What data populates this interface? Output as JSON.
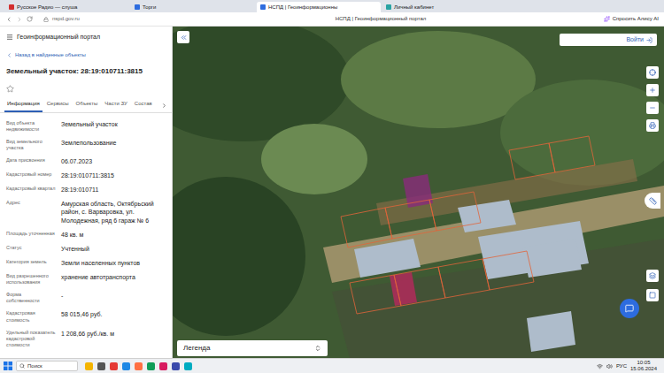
{
  "browser": {
    "tabs": [
      {
        "label": "Русское Радио — слуша",
        "selected": false
      },
      {
        "label": "Торги",
        "selected": false
      },
      {
        "label": "НСПД | Геоинформационны",
        "selected": true
      },
      {
        "label": "Личный кабинет",
        "selected": false
      }
    ],
    "address": "nspd.gov.ru",
    "title": "НСПД | Геоинформационный портал",
    "assistant": "Спросить Алису AI"
  },
  "panel": {
    "title": "Геоинформационный портал",
    "back": "Назад в найденные объекты",
    "heading": "Земельный участок: 28:19:010711:3815",
    "tabs": [
      {
        "label": "Информация",
        "selected": true
      },
      {
        "label": "Сервисы",
        "selected": false
      },
      {
        "label": "Объекты",
        "selected": false
      },
      {
        "label": "Части ЗУ",
        "selected": false
      },
      {
        "label": "Состав",
        "selected": false
      }
    ],
    "properties": [
      {
        "label": "Вид объекта недвижимости",
        "value": "Земельный участок"
      },
      {
        "label": "Вид земельного участка",
        "value": "Землепользование"
      },
      {
        "label": "Дата присвоения",
        "value": "06.07.2023"
      },
      {
        "label": "Кадастровый номер",
        "value": "28:19:010711:3815"
      },
      {
        "label": "Кадастровый квартал",
        "value": "28:19:010711"
      },
      {
        "label": "Адрес",
        "value": "Амурская область, Октябрьский район, с. Варваровка, ул. Молодежная, ряд 6 гараж № 6"
      },
      {
        "label": "Площадь уточненная",
        "value": "48 кв. м"
      },
      {
        "label": "Статус",
        "value": "Учтенный"
      },
      {
        "label": "Категория земель",
        "value": "Земли населенных пунктов"
      },
      {
        "label": "Вид разрешенного использования",
        "value": "хранение автотранспорта"
      },
      {
        "label": "Форма собственности",
        "value": "-"
      },
      {
        "label": "Кадастровая стоимость",
        "value": "58 015,46 руб."
      },
      {
        "label": "Удельный показатель кадастровой стоимости",
        "value": "1 208,66 руб./кв. м"
      }
    ]
  },
  "map": {
    "login": "Войти",
    "legend": "Легенда"
  },
  "taskbar": {
    "search": "Поиск",
    "lang": "РУС",
    "time": "10:05",
    "date": "15.06.2024"
  }
}
